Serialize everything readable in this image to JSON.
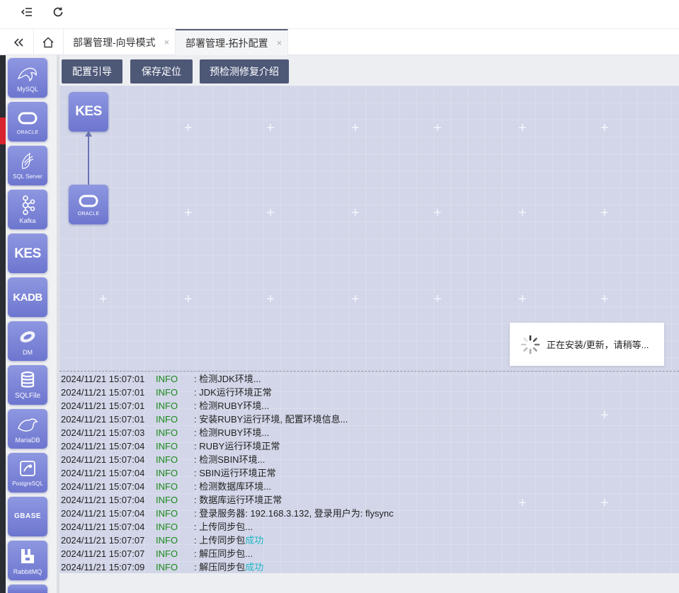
{
  "toolbar": {
    "collapse_icon": "menu-fold-icon",
    "refresh_icon": "refresh-icon"
  },
  "tabs": {
    "back_icon": "double-chevron-left-icon",
    "home_icon": "home-icon",
    "items": [
      {
        "label": "部署管理-向导模式",
        "close": "×"
      },
      {
        "label": "部署管理-拓扑配置",
        "close": "×"
      }
    ]
  },
  "sidebar": {
    "items": [
      {
        "name": "mysql",
        "glyph": "🐬",
        "label": "MySQL"
      },
      {
        "name": "oracle",
        "glyph": "",
        "label": "ORACLE"
      },
      {
        "name": "sqlserver",
        "glyph": "",
        "label": "SQL Server"
      },
      {
        "name": "kafka",
        "glyph": "",
        "label": "Kafka"
      },
      {
        "name": "kes",
        "glyph": "KES",
        "label": ""
      },
      {
        "name": "kadb",
        "glyph": "KADB",
        "label": ""
      },
      {
        "name": "dm",
        "glyph": "",
        "label": "DM"
      },
      {
        "name": "sqlfile",
        "glyph": "",
        "label": "SQLFile"
      },
      {
        "name": "mariadb",
        "glyph": "",
        "label": "MariaDB"
      },
      {
        "name": "postgresql",
        "glyph": "",
        "label": "PostgreSQL"
      },
      {
        "name": "gbase",
        "glyph": "GBASE",
        "label": ""
      },
      {
        "name": "rabbitmq",
        "glyph": "",
        "label": "RabbitMQ"
      }
    ]
  },
  "actions": {
    "guide": "配置引导",
    "save_position": "保存定位",
    "precheck": "预检测修复介绍"
  },
  "topology": {
    "kes_node": {
      "glyph": "KES"
    },
    "oracle_node": {
      "label": "ORACLE"
    }
  },
  "loading": {
    "text": "正在安装/更新，请稍等..."
  },
  "log": [
    {
      "ts": "2024/11/21 15:07:01",
      "level": "INFO",
      "msg": ": 检测JDK环境...",
      "ok": ""
    },
    {
      "ts": "2024/11/21 15:07:01",
      "level": "INFO",
      "msg": ": JDK运行环境正常",
      "ok": ""
    },
    {
      "ts": "2024/11/21 15:07:01",
      "level": "INFO",
      "msg": ": 检测RUBY环境...",
      "ok": ""
    },
    {
      "ts": "2024/11/21 15:07:01",
      "level": "INFO",
      "msg": ": 安装RUBY运行环境, 配置环境信息...",
      "ok": ""
    },
    {
      "ts": "2024/11/21 15:07:03",
      "level": "INFO",
      "msg": ": 检测RUBY环境...",
      "ok": ""
    },
    {
      "ts": "2024/11/21 15:07:04",
      "level": "INFO",
      "msg": ": RUBY运行环境正常",
      "ok": ""
    },
    {
      "ts": "2024/11/21 15:07:04",
      "level": "INFO",
      "msg": ": 检测SBIN环境...",
      "ok": ""
    },
    {
      "ts": "2024/11/21 15:07:04",
      "level": "INFO",
      "msg": ": SBIN运行环境正常",
      "ok": ""
    },
    {
      "ts": "2024/11/21 15:07:04",
      "level": "INFO",
      "msg": ": 检测数据库环境...",
      "ok": ""
    },
    {
      "ts": "2024/11/21 15:07:04",
      "level": "INFO",
      "msg": ": 数据库运行环境正常",
      "ok": ""
    },
    {
      "ts": "2024/11/21 15:07:04",
      "level": "INFO",
      "msg": ": 登录服务器: 192.168.3.132, 登录用户为: flysync",
      "ok": ""
    },
    {
      "ts": "2024/11/21 15:07:04",
      "level": "INFO",
      "msg": ": 上传同步包...",
      "ok": ""
    },
    {
      "ts": "2024/11/21 15:07:07",
      "level": "INFO",
      "msg": ": 上传同步包",
      "ok": "成功"
    },
    {
      "ts": "2024/11/21 15:07:07",
      "level": "INFO",
      "msg": ": 解压同步包...",
      "ok": ""
    },
    {
      "ts": "2024/11/21 15:07:09",
      "level": "INFO",
      "msg": ": 解压同步包",
      "ok": "成功"
    }
  ],
  "colors": {
    "accent": "#4d5877",
    "tile": "#7a83d6",
    "canvas": "#d2d6e8",
    "info": "#1a8a1a",
    "success": "#1fb7c7",
    "sidebar_alert": "#d9232e"
  }
}
